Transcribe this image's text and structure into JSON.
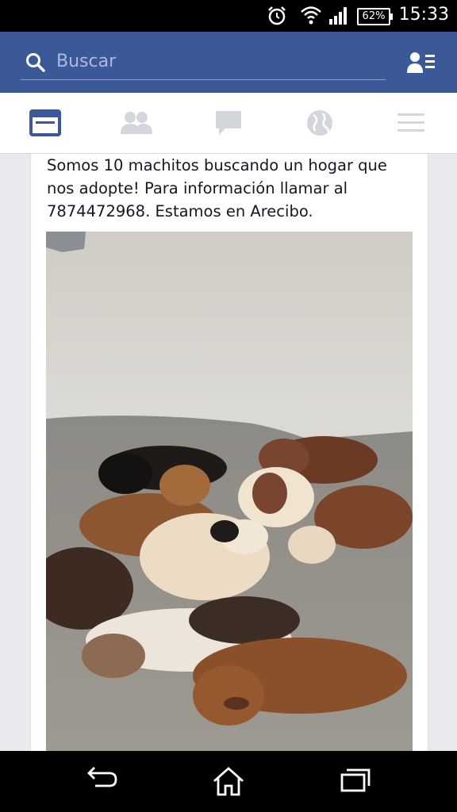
{
  "status_bar": {
    "time": "15:33",
    "battery": "62%",
    "icons": [
      "alarm-icon",
      "wifi-icon",
      "signal-icon",
      "battery-icon"
    ]
  },
  "search": {
    "placeholder": "Buscar"
  },
  "nav_tabs": [
    {
      "name": "news-feed",
      "icon": "news-feed-icon",
      "active": true
    },
    {
      "name": "friend-requests",
      "icon": "friends-icon",
      "active": false
    },
    {
      "name": "messages",
      "icon": "chat-icon",
      "active": false
    },
    {
      "name": "notifications",
      "icon": "globe-icon",
      "active": false
    },
    {
      "name": "more",
      "icon": "menu-icon",
      "active": false
    }
  ],
  "post": {
    "text": "Somos 10 machitos buscando un hogar que\nnos adopte! Para información llamar al\n7874472968. Estamos en Arecibo."
  },
  "colors": {
    "brand": "#3b5998",
    "active_tab": "#3b5998",
    "inactive_tab": "#d3d6db"
  },
  "system_nav": [
    "back-icon",
    "home-icon",
    "recent-apps-icon"
  ]
}
